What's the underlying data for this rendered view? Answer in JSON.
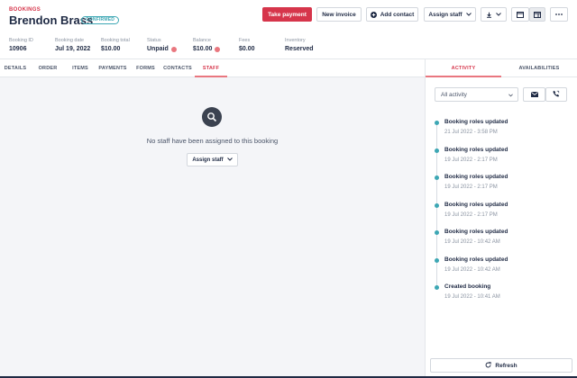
{
  "header": {
    "eyebrow": "BOOKINGS",
    "title": "Brendon Brass",
    "status_badge": "CONFIRMED",
    "take_payment": "Take payment",
    "new_invoice": "New invoice",
    "add_contact": "Add contact",
    "assign_staff": "Assign staff"
  },
  "info": [
    {
      "label": "Booking ID",
      "value": "10906"
    },
    {
      "label": "Booking date",
      "value": "Jul 19, 2022"
    },
    {
      "label": "Booking total",
      "value": "$10.00"
    },
    {
      "label": "Status",
      "value": "Unpaid"
    },
    {
      "label": "Balance",
      "value": "$10.00"
    },
    {
      "label": "Fees",
      "value": "$0.00"
    },
    {
      "label": "Inventory",
      "value": "Reserved"
    }
  ],
  "tabs": [
    "DETAILS",
    "ORDER",
    "ITEMS",
    "PAYMENTS",
    "FORMS",
    "CONTACTS",
    "STAFF"
  ],
  "active_tab": "STAFF",
  "staff": {
    "empty_message": "No staff have been assigned to this booking",
    "assign_button": "Assign staff"
  },
  "right_tabs": [
    "ACTIVITY",
    "AVAILABILITIES"
  ],
  "activity_filter": "All activity",
  "activity": [
    {
      "title": "Booking roles updated",
      "date": "21 Jul 2022 - 3:58 PM"
    },
    {
      "title": "Booking roles updated",
      "date": "19 Jul 2022 - 2:17 PM"
    },
    {
      "title": "Booking roles updated",
      "date": "19 Jul 2022 - 2:17 PM"
    },
    {
      "title": "Booking roles updated",
      "date": "19 Jul 2022 - 2:17 PM"
    },
    {
      "title": "Booking roles updated",
      "date": "19 Jul 2022 - 10:42 AM"
    },
    {
      "title": "Booking roles updated",
      "date": "19 Jul 2022 - 10:42 AM"
    },
    {
      "title": "Created booking",
      "date": "19 Jul 2022 - 10:41 AM"
    }
  ],
  "refresh_label": "Refresh",
  "colors": {
    "accent": "#d6354b",
    "teal": "#3da7b4",
    "text": "#1f2a44"
  }
}
